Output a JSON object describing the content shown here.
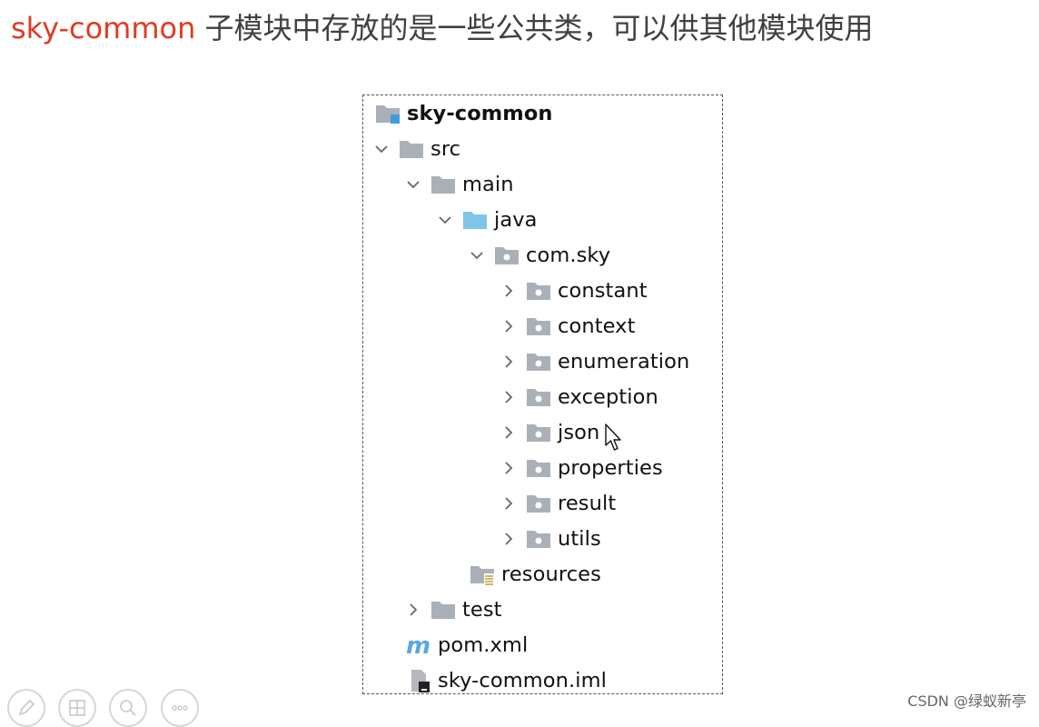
{
  "heading": {
    "accent": "sky-common",
    "text": " 子模块中存放的是一些公共类，可以供其他模块使用"
  },
  "tree": {
    "root": "sky-common",
    "src": "src",
    "main": "main",
    "java": "java",
    "package": "com.sky",
    "subpackages": [
      "constant",
      "context",
      "enumeration",
      "exception",
      "json",
      "properties",
      "result",
      "utils"
    ],
    "resources": "resources",
    "test": "test",
    "pom": "pom.xml",
    "iml": "sky-common.iml"
  },
  "watermark": "CSDN @绿蚁新亭",
  "colors": {
    "accent": "#e03b24",
    "folder_gray": "#aab0b8",
    "folder_java": "#7ec5e8",
    "module_blue": "#3d9be0",
    "maven_blue": "#5aa8e0"
  },
  "icons": {
    "module": "module-folder-icon",
    "folder": "folder-icon",
    "source_root": "source-root-folder-icon",
    "package": "package-folder-icon",
    "resources": "resources-folder-icon",
    "maven": "maven-m-icon",
    "iml": "iml-file-icon",
    "expanded": "chevron-down-icon",
    "collapsed": "chevron-right-icon"
  }
}
